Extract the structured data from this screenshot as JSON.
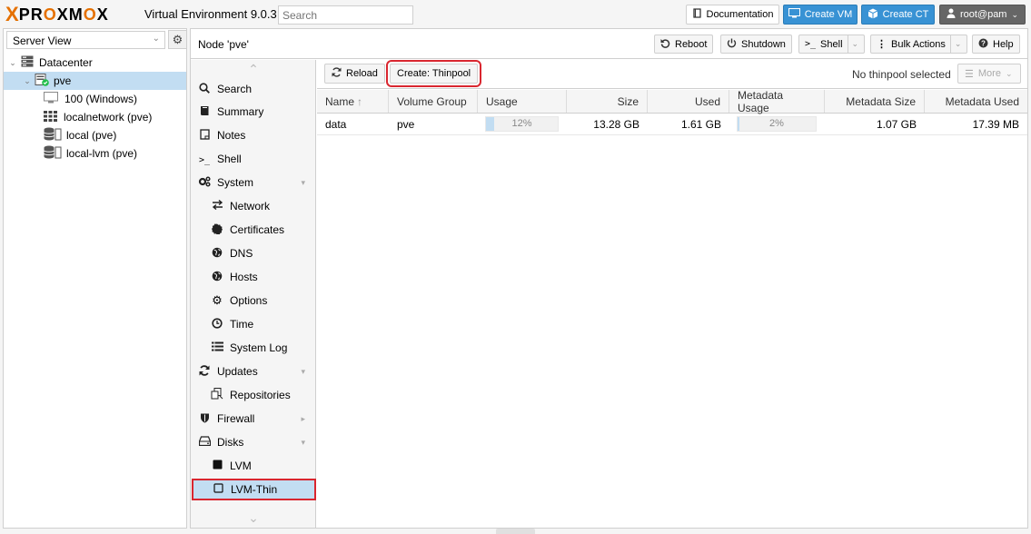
{
  "header": {
    "logo_x": "X",
    "logo_word_a": "PR",
    "logo_word_o": "O",
    "logo_word_b": "XM",
    "logo_word_o2": "O",
    "logo_word_c": "X",
    "version": "Virtual Environment 9.0.3",
    "search_placeholder": "Search",
    "documentation": "Documentation",
    "create_vm": "Create VM",
    "create_ct": "Create CT",
    "user": "root@pam"
  },
  "tree": {
    "view": "Server View",
    "items": [
      {
        "label": "Datacenter",
        "icon": "datacenter-icon"
      },
      {
        "label": "pve",
        "icon": "node-online-icon"
      },
      {
        "label": "100 (Windows)",
        "icon": "vm-icon"
      },
      {
        "label": "localnetwork (pve)",
        "icon": "sdn-icon"
      },
      {
        "label": "local (pve)",
        "icon": "storage-icon"
      },
      {
        "label": "local-lvm (pve)",
        "icon": "storage-icon"
      }
    ]
  },
  "node": {
    "title": "Node 'pve'",
    "reboot": "Reboot",
    "shutdown": "Shutdown",
    "shell": "Shell",
    "bulk": "Bulk Actions",
    "help": "Help"
  },
  "nav": [
    {
      "label": "Search",
      "icon": "search-icon"
    },
    {
      "label": "Summary",
      "icon": "book-icon"
    },
    {
      "label": "Notes",
      "icon": "notes-icon"
    },
    {
      "label": "Shell",
      "icon": "terminal-icon"
    },
    {
      "label": "System",
      "icon": "cogs-icon"
    },
    {
      "label": "Network",
      "icon": "exchange-icon"
    },
    {
      "label": "Certificates",
      "icon": "certificate-icon"
    },
    {
      "label": "DNS",
      "icon": "globe-icon"
    },
    {
      "label": "Hosts",
      "icon": "globe-icon"
    },
    {
      "label": "Options",
      "icon": "gear-icon"
    },
    {
      "label": "Time",
      "icon": "clock-icon"
    },
    {
      "label": "System Log",
      "icon": "list-icon"
    },
    {
      "label": "Updates",
      "icon": "refresh-icon"
    },
    {
      "label": "Repositories",
      "icon": "files-icon"
    },
    {
      "label": "Firewall",
      "icon": "shield-icon"
    },
    {
      "label": "Disks",
      "icon": "hdd-icon"
    },
    {
      "label": "LVM",
      "icon": "square-icon"
    },
    {
      "label": "LVM-Thin",
      "icon": "square-outline-icon"
    }
  ],
  "content": {
    "reload": "Reload",
    "create_thinpool": "Create: Thinpool",
    "no_selection": "No thinpool selected",
    "more": "More",
    "columns": [
      "Name",
      "Volume Group",
      "Usage",
      "Size",
      "Used",
      "Metadata Usage",
      "Metadata Size",
      "Metadata Used"
    ],
    "rows": [
      {
        "name": "data",
        "vg": "pve",
        "usage_pct": 12,
        "usage_label": "12%",
        "size": "13.28 GB",
        "used": "1.61 GB",
        "meta_usage_pct": 2,
        "meta_usage_label": "2%",
        "meta_size": "1.07 GB",
        "meta_used": "17.39 MB"
      }
    ]
  },
  "colors": {
    "accent": "#3892d4",
    "logo_orange": "#e57000",
    "selection": "#c2ddf2",
    "highlight_red": "#d9262f"
  }
}
